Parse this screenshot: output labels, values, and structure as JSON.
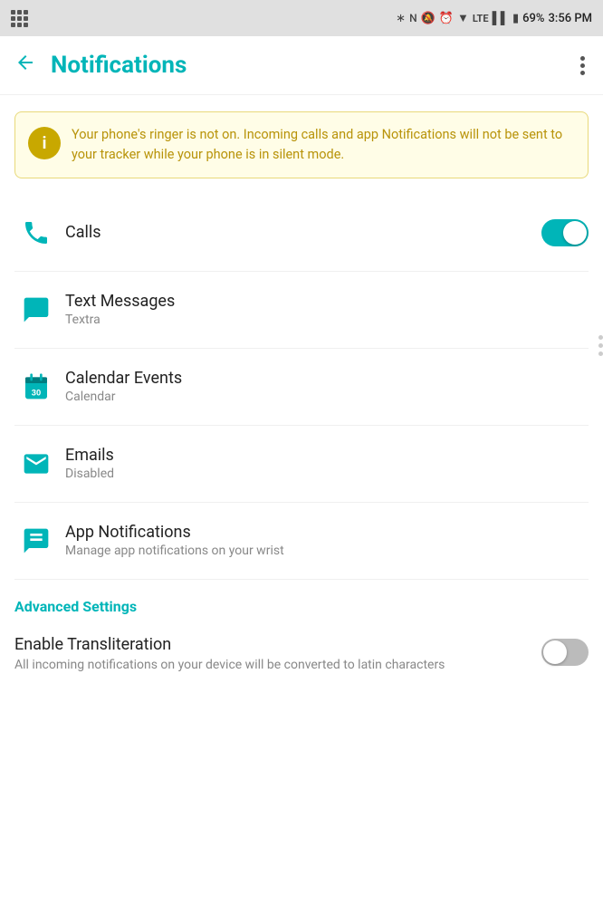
{
  "statusBar": {
    "battery": "69%",
    "time": "3:56 PM",
    "signal": "LTE"
  },
  "appBar": {
    "title": "Notifications",
    "backLabel": "←",
    "moreLabel": "⋮"
  },
  "warningBanner": {
    "text": "Your phone's ringer is not on. Incoming calls and app Notifications will not be sent to your tracker while your phone is in silent mode."
  },
  "items": [
    {
      "id": "calls",
      "title": "Calls",
      "subtitle": "",
      "hasToggle": true,
      "toggleOn": true
    },
    {
      "id": "text-messages",
      "title": "Text Messages",
      "subtitle": "Textra",
      "hasToggle": false,
      "toggleOn": false
    },
    {
      "id": "calendar-events",
      "title": "Calendar Events",
      "subtitle": "Calendar",
      "hasToggle": false,
      "toggleOn": false
    },
    {
      "id": "emails",
      "title": "Emails",
      "subtitle": "Disabled",
      "hasToggle": false,
      "toggleOn": false
    },
    {
      "id": "app-notifications",
      "title": "App Notifications",
      "subtitle": "Manage app notifications on your wrist",
      "hasToggle": false,
      "toggleOn": false
    }
  ],
  "advancedSettings": {
    "sectionTitle": "Advanced Settings",
    "items": [
      {
        "id": "transliteration",
        "title": "Enable Transliteration",
        "subtitle": "All incoming notifications on your device will be converted to latin characters",
        "toggleOn": false
      }
    ]
  }
}
